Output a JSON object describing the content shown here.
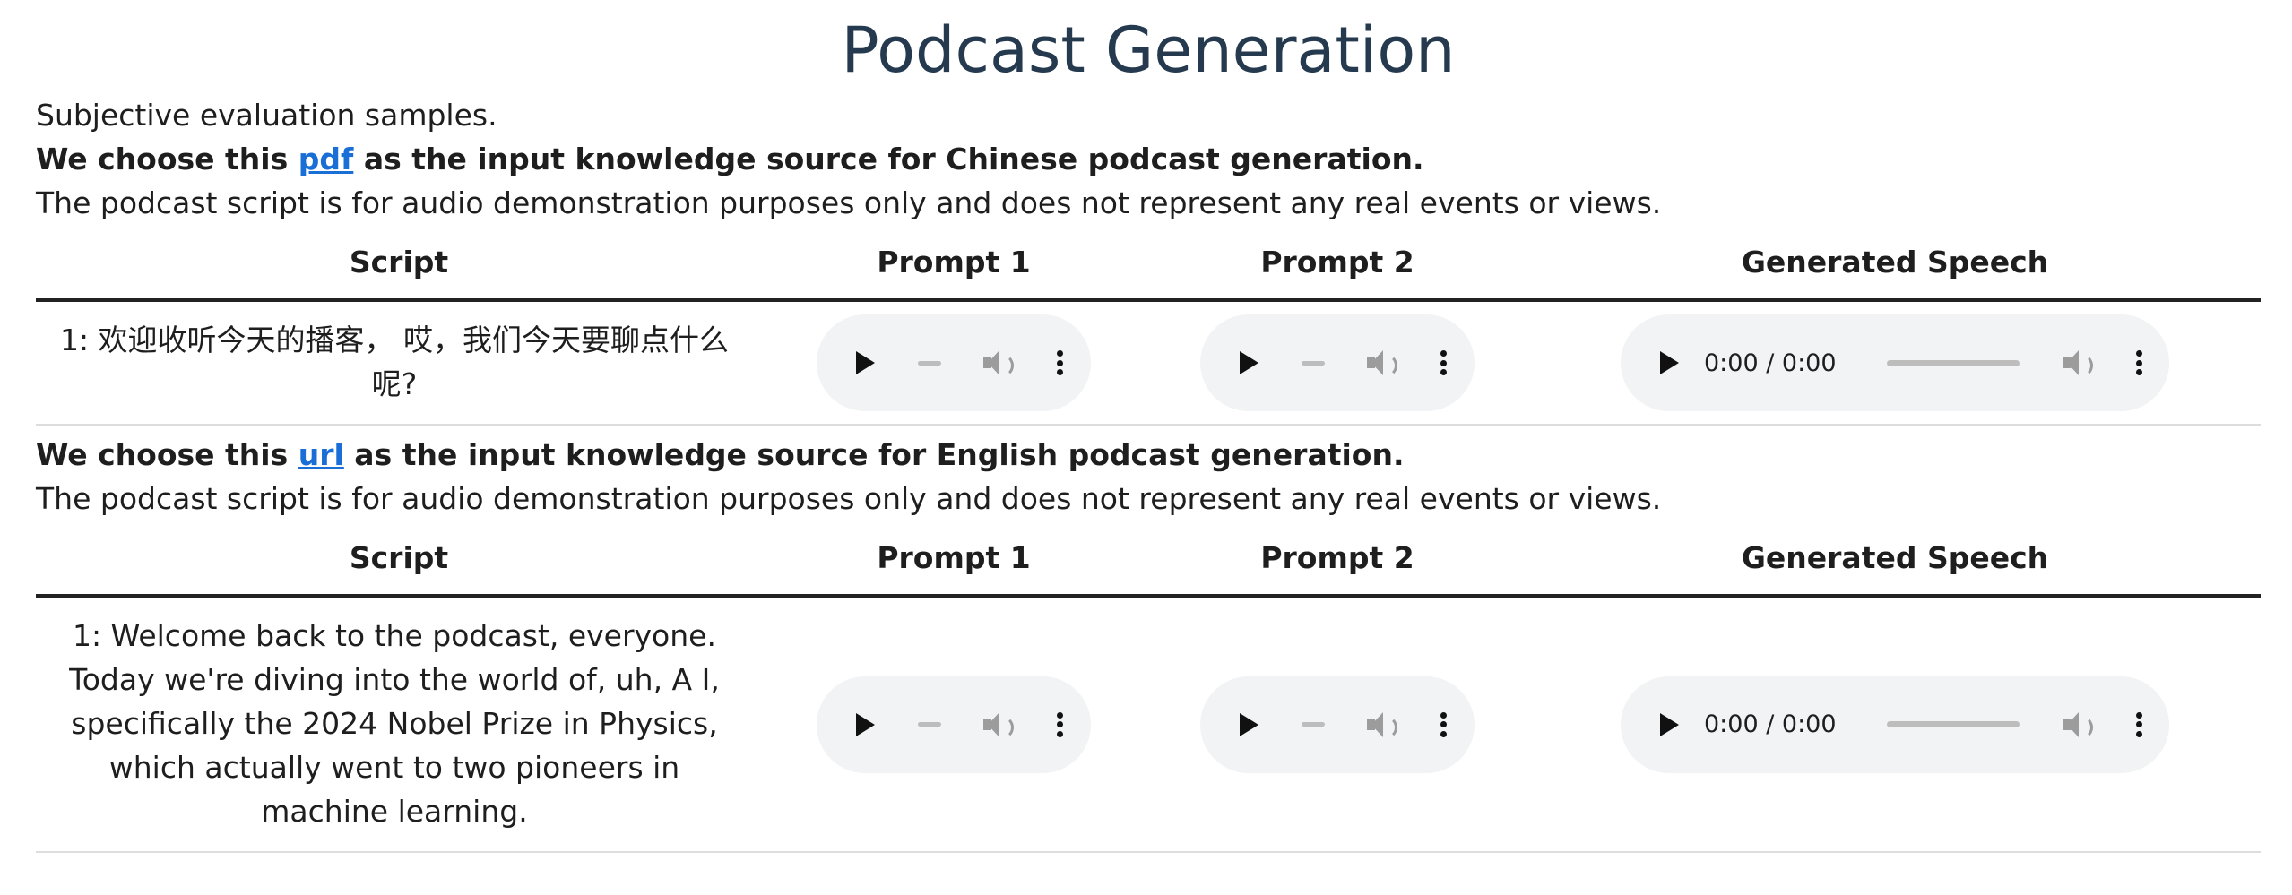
{
  "page_title": "Podcast Generation",
  "intro": "Subjective evaluation samples.",
  "sections": [
    {
      "heading_prefix": "We choose this ",
      "link_text": "pdf",
      "heading_suffix": " as the input knowledge source for Chinese podcast generation.",
      "disclaimer": "The podcast script is for audio demonstration purposes only and does not represent any real events or views.",
      "columns": [
        "Script",
        "Prompt 1",
        "Prompt 2",
        "Generated Speech"
      ],
      "rows": [
        {
          "script": "1: 欢迎收听今天的播客， 哎，我们今天要聊点什么呢?",
          "generated_time": "0:00 / 0:00"
        }
      ]
    },
    {
      "heading_prefix": "We choose this ",
      "link_text": "url",
      "heading_suffix": " as the input knowledge source for English podcast generation.",
      "disclaimer": "The podcast script is for audio demonstration purposes only and does not represent any real events or views.",
      "columns": [
        "Script",
        "Prompt 1",
        "Prompt 2",
        "Generated Speech"
      ],
      "rows": [
        {
          "script": "1: Welcome back to the podcast, everyone. Today we're diving into the world of, uh, A I, specifically the 2024 Nobel Prize in Physics, which actually went to two pioneers in machine learning.",
          "generated_time": "0:00 / 0:00"
        }
      ]
    }
  ],
  "icons": {
    "play": "play-icon",
    "volume": "volume-icon",
    "more": "more-options-icon"
  }
}
